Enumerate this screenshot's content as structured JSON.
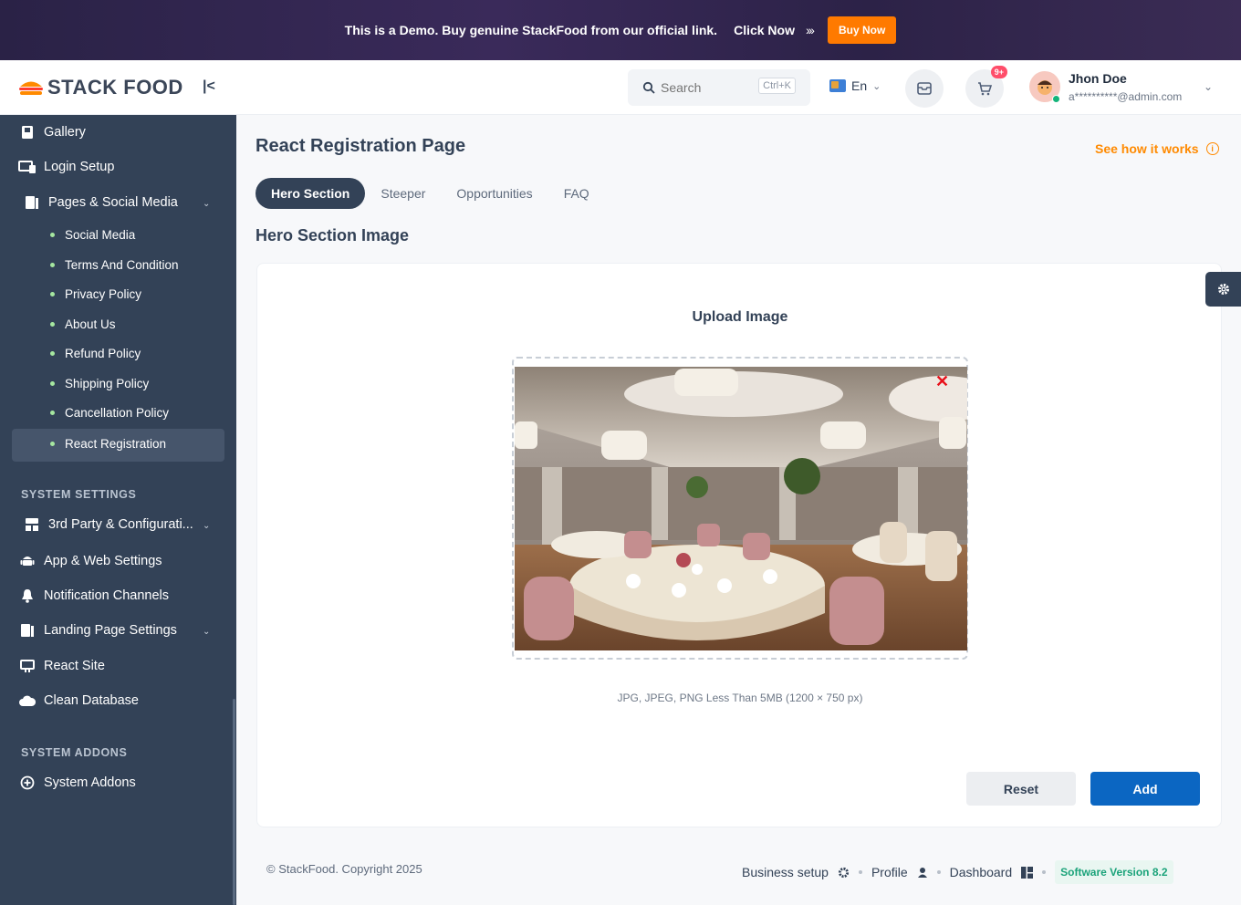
{
  "banner": {
    "text": "This is a Demo. Buy genuine StackFood from our official link.",
    "click_text": "Click Now",
    "buy_label": "Buy Now"
  },
  "brand": {
    "name": "STACK FOOD"
  },
  "sidebar": {
    "items_top": [
      {
        "label": "Gallery",
        "icon": "gallery-icon"
      },
      {
        "label": "Login Setup",
        "icon": "login-setup-icon"
      },
      {
        "label": "Pages & Social Media",
        "icon": "pages-icon"
      }
    ],
    "sub_items": [
      "Social Media",
      "Terms And Condition",
      "Privacy Policy",
      "About Us",
      "Refund Policy",
      "Shipping Policy",
      "Cancellation Policy",
      "React Registration"
    ],
    "system_settings_label": "SYSTEM SETTINGS",
    "system_items": [
      {
        "label": "3rd Party & Configurati...",
        "icon": "third-party-icon"
      },
      {
        "label": "App & Web Settings",
        "icon": "android-icon"
      },
      {
        "label": "Notification Channels",
        "icon": "bell-icon"
      },
      {
        "label": "Landing Page Settings",
        "icon": "landing-icon"
      },
      {
        "label": "React Site",
        "icon": "react-site-icon"
      },
      {
        "label": "Clean Database",
        "icon": "cloud-icon"
      }
    ],
    "system_addons_label": "SYSTEM ADDONS",
    "addon_items": [
      {
        "label": "System Addons",
        "icon": "plus-circle-icon"
      }
    ]
  },
  "header": {
    "search_placeholder": "Search",
    "search_shortcut": "Ctrl+K",
    "language": "En",
    "cart_badge": "9+",
    "user_name": "Jhon Doe",
    "user_email": "a**********@admin.com"
  },
  "main": {
    "page_title": "React Registration Page",
    "how_link": "See how it works",
    "tabs": [
      "Hero Section",
      "Steeper",
      "Opportunities",
      "FAQ"
    ],
    "section_title": "Hero Section Image",
    "upload_title": "Upload Image",
    "hint": "JPG, JPEG, PNG Less Than 5MB (1200 × 750 px)",
    "reset_label": "Reset",
    "add_label": "Add"
  },
  "footer": {
    "copyright": "© StackFood. Copyright 2025",
    "business_setup": "Business setup",
    "profile": "Profile",
    "dashboard": "Dashboard",
    "version": "Software Version 8.2"
  },
  "colors": {
    "sidebar": "#334257",
    "accent": "#ff8a00",
    "primary": "#0b66c2",
    "bullet": "#a6e7a0"
  }
}
